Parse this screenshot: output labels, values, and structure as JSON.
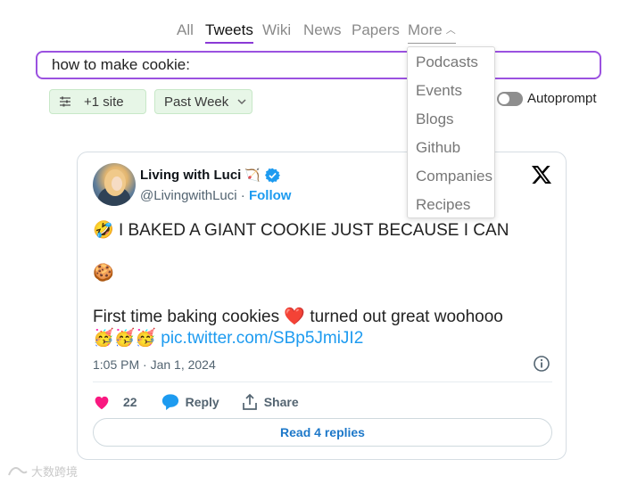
{
  "tabs": [
    {
      "label": "All"
    },
    {
      "label": "Tweets"
    },
    {
      "label": "Wiki"
    },
    {
      "label": "News"
    },
    {
      "label": "Papers"
    },
    {
      "label": "More"
    }
  ],
  "active_tab": "Tweets",
  "more_menu": {
    "items": [
      "Podcasts",
      "Events",
      "Blogs",
      "Github",
      "Companies",
      "Recipes"
    ]
  },
  "search": {
    "value": "how to make cookie:"
  },
  "filters": {
    "site_label": "+1 site",
    "time_label": "Past Week"
  },
  "autoprompt": {
    "label": "Autoprompt",
    "enabled": false
  },
  "tweet": {
    "author_name": "Living with Luci",
    "author_emoji": "🏹",
    "handle": "@LivingwithLuci",
    "separator": "·",
    "follow_label": "Follow",
    "line1_emoji": "🤣",
    "line1_text": "I BAKED A GIANT COOKIE JUST BECAUSE I CAN",
    "line2_emoji": "🍪",
    "line3_text_a": "First time baking cookies",
    "line3_heart": "❤️",
    "line3_text_b": "turned out great woohooo",
    "line4_emojis": "🥳🥳🥳",
    "link": "pic.twitter.com/SBp5JmiJI2",
    "timestamp": "1:05 PM · Jan 1, 2024",
    "likes": "22",
    "reply_label": "Reply",
    "share_label": "Share",
    "read_replies_label": "Read 4 replies"
  },
  "watermark": {
    "text": "大数跨境"
  },
  "colors": {
    "accent_purple": "#9b51e0",
    "twitter_blue": "#1d9bf0",
    "chip_green": "#e7f6e7",
    "like_pink": "#f91880"
  }
}
